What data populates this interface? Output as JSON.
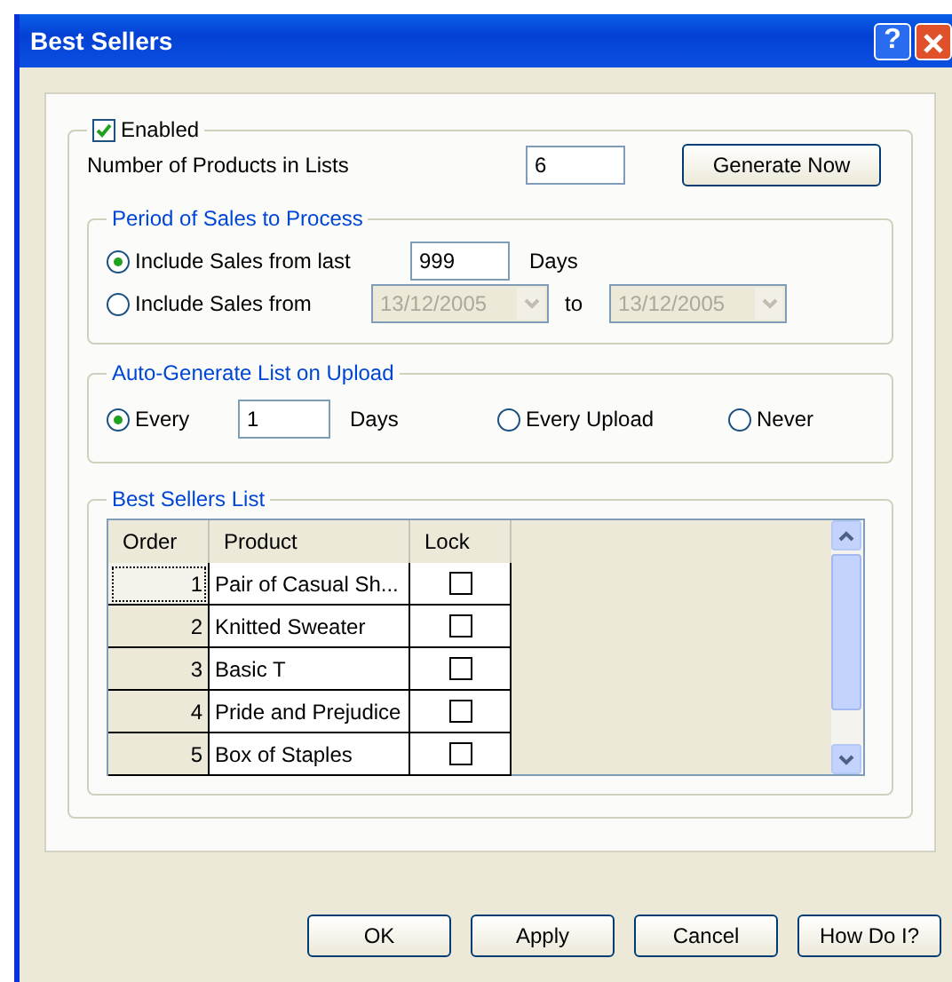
{
  "window": {
    "title": "Best Sellers",
    "title_buttons": [
      "?"
    ]
  },
  "enabled": {
    "label": "Enabled",
    "checked": true
  },
  "products_count": {
    "label": "Number of Products in Lists",
    "value": "6"
  },
  "generate_button": "Generate Now",
  "period": {
    "title": "Period of Sales to Process",
    "options": [
      {
        "kind": "days",
        "label": "Include Sales from last",
        "selected": true,
        "value": "999",
        "unit": "Days"
      },
      {
        "kind": "range",
        "label": "Include Sales from",
        "selected": false,
        "from": "13/12/2005",
        "to_label": "to",
        "to": "13/12/2005"
      }
    ]
  },
  "auto_generate": {
    "title": "Auto-Generate List on Upload",
    "options": [
      {
        "kind": "days",
        "label": "Every",
        "selected": true,
        "value": "1",
        "unit": "Days"
      },
      {
        "kind": "plain",
        "label": "Every Upload",
        "selected": false
      },
      {
        "kind": "plain",
        "label": "Never",
        "selected": false
      }
    ]
  },
  "best_sellers": {
    "title": "Best Sellers List",
    "columns": [
      "Order",
      "Product",
      "Lock"
    ],
    "rows": [
      {
        "order": "1",
        "product": "Pair of Casual Sh...",
        "locked": false,
        "focused": true
      },
      {
        "order": "2",
        "product": "Knitted Sweater",
        "locked": false,
        "focused": false
      },
      {
        "order": "3",
        "product": "Basic T",
        "locked": false,
        "focused": false
      },
      {
        "order": "4",
        "product": "Pride and Prejudice",
        "locked": false,
        "focused": false
      },
      {
        "order": "5",
        "product": "Box of Staples",
        "locked": false,
        "focused": false
      }
    ]
  },
  "buttons": [
    "OK",
    "Apply",
    "Cancel",
    "How Do I?"
  ]
}
